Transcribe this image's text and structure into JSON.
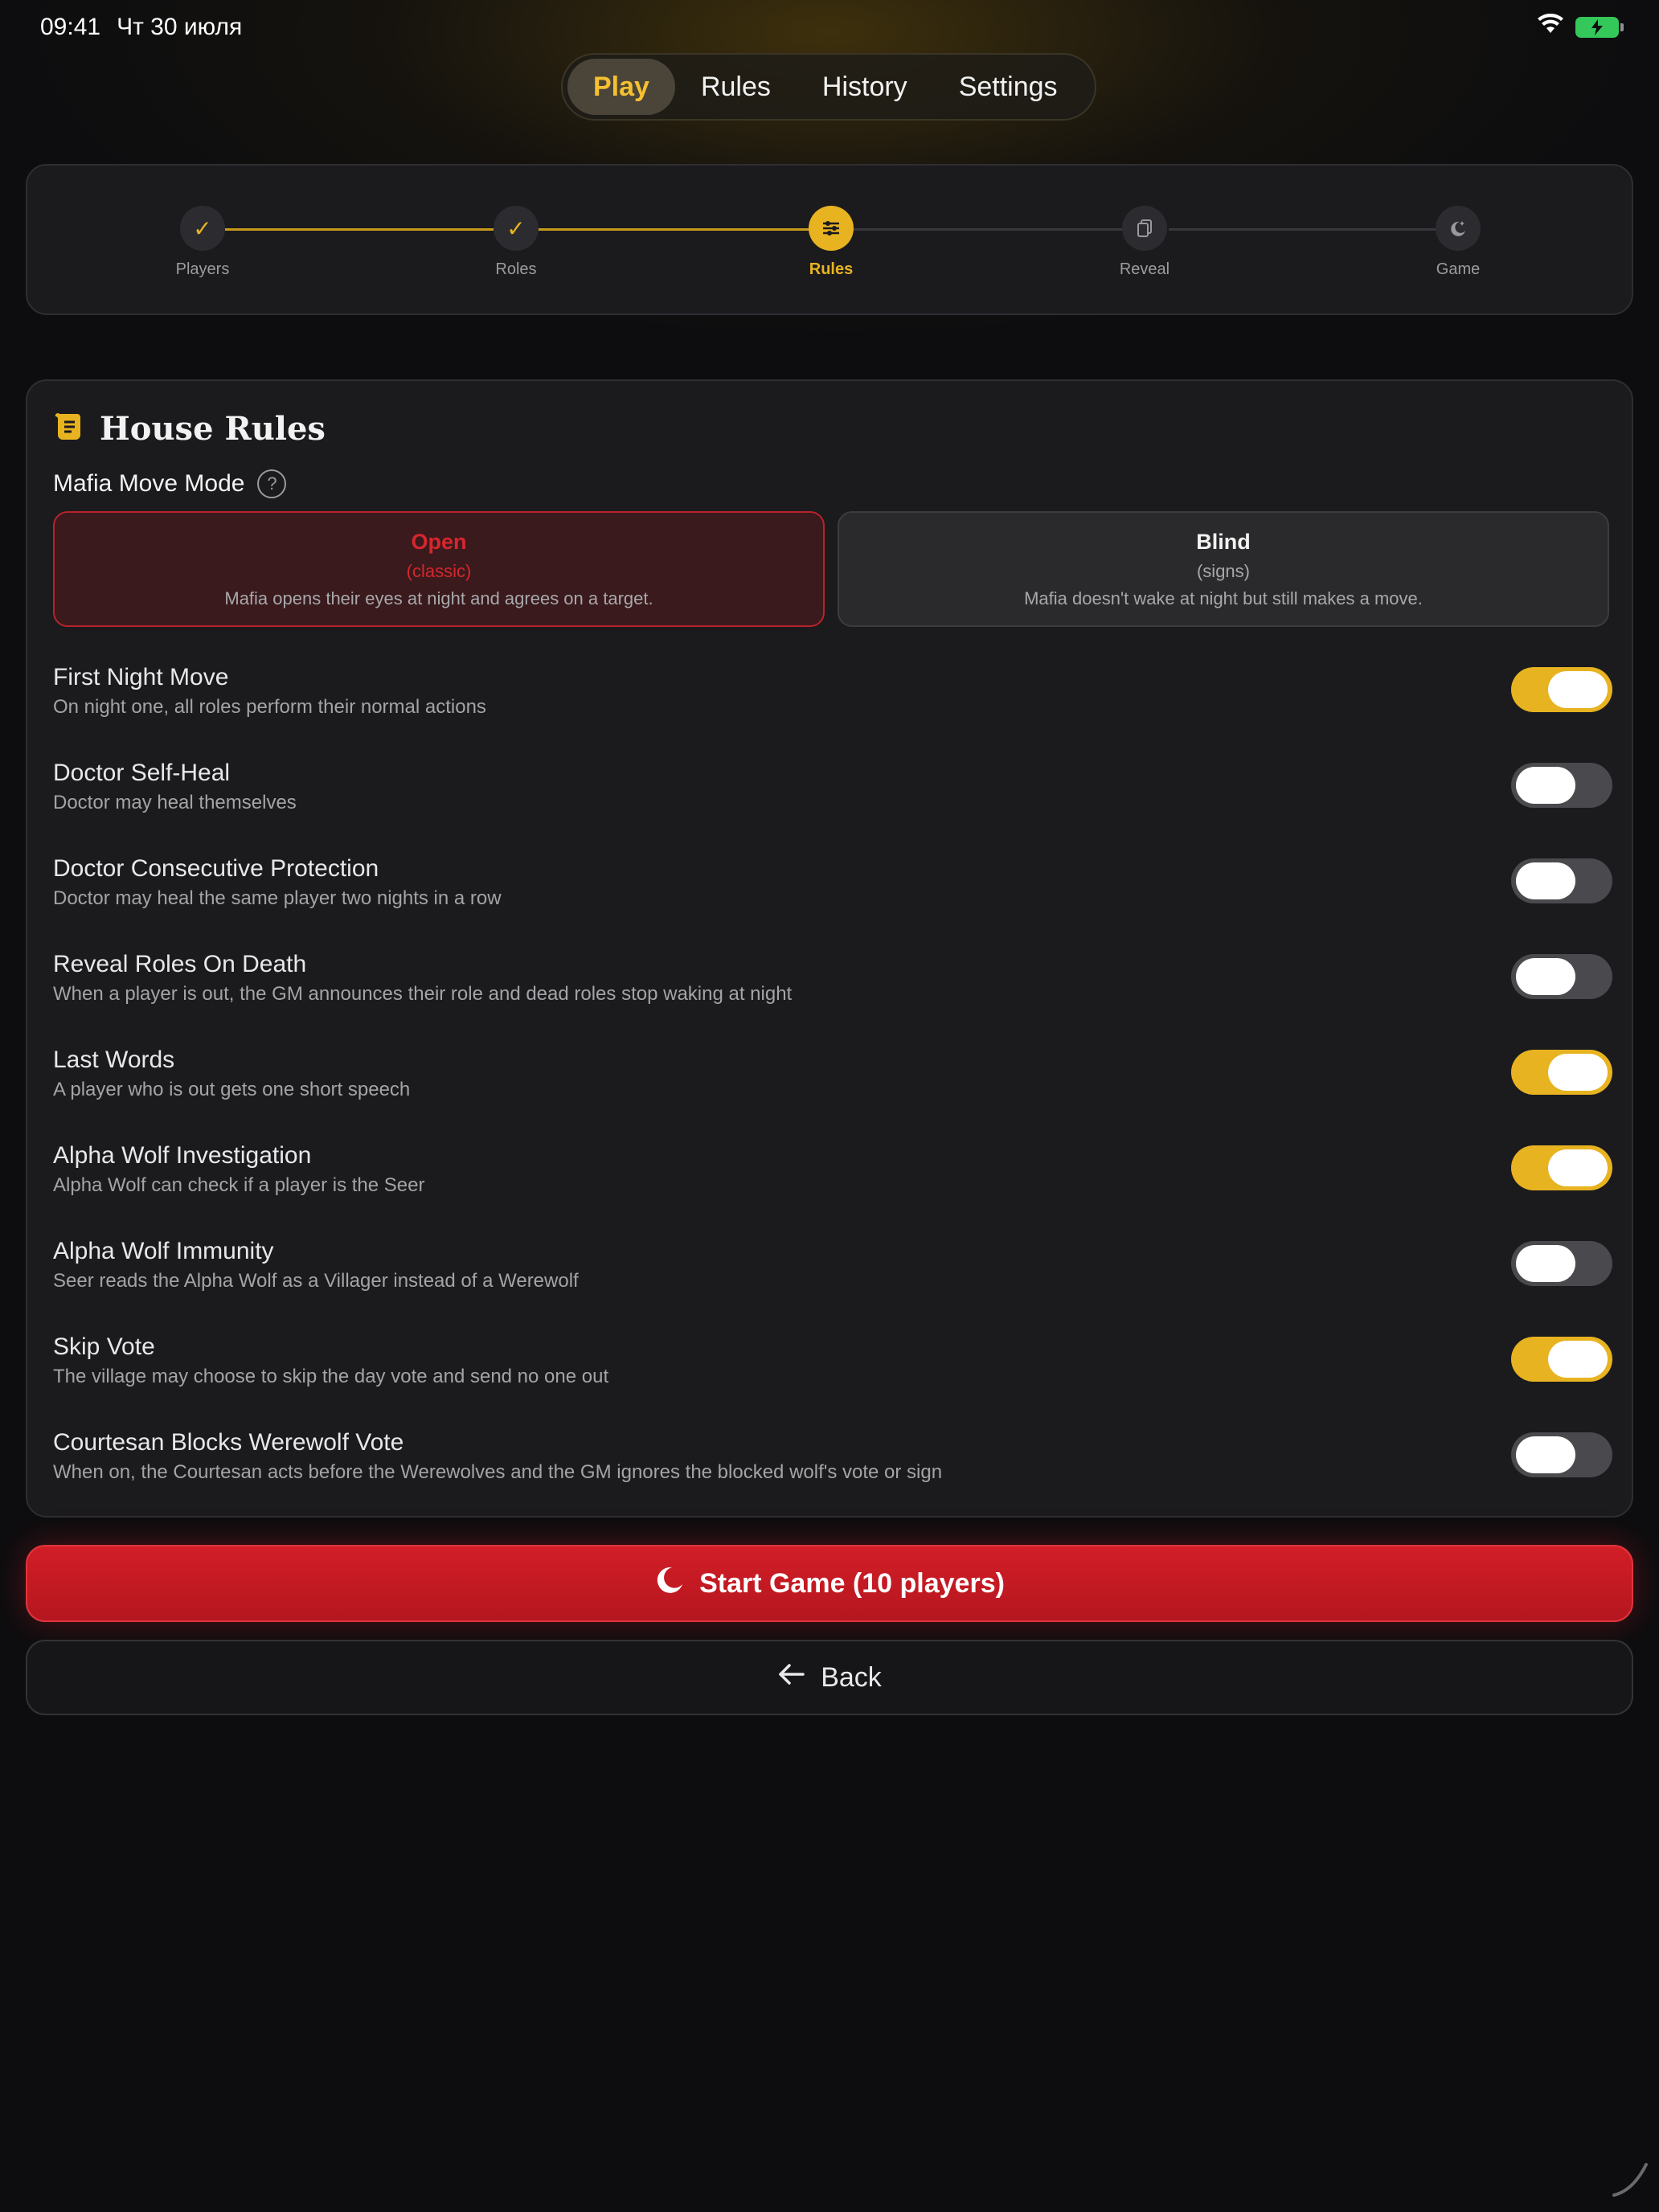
{
  "status_bar": {
    "time": "09:41",
    "date": "Чт 30 июля",
    "wifi_icon": "wifi-icon",
    "battery_icon": "battery-charging-icon"
  },
  "tabs": [
    {
      "label": "Play",
      "active": true
    },
    {
      "label": "Rules",
      "active": false
    },
    {
      "label": "History",
      "active": false
    },
    {
      "label": "Settings",
      "active": false
    }
  ],
  "stepper": {
    "steps": [
      {
        "label": "Players",
        "state": "done",
        "icon": "check-icon"
      },
      {
        "label": "Roles",
        "state": "done",
        "icon": "check-icon"
      },
      {
        "label": "Rules",
        "state": "current",
        "icon": "sliders-icon"
      },
      {
        "label": "Reveal",
        "state": "pending",
        "icon": "cards-icon"
      },
      {
        "label": "Game",
        "state": "pending",
        "icon": "moon-star-icon"
      }
    ]
  },
  "house_rules": {
    "title": "House Rules",
    "title_icon": "scroll-icon",
    "mafia_move_mode": {
      "label": "Mafia Move Mode",
      "help_icon": "question-circle-icon",
      "help_glyph": "?",
      "options": [
        {
          "name": "Open",
          "sub": "(classic)",
          "description": "Mafia opens their eyes at night and agrees on a target.",
          "selected": true
        },
        {
          "name": "Blind",
          "sub": "(signs)",
          "description": "Mafia doesn't wake at night but still makes a move.",
          "selected": false
        }
      ]
    },
    "rules": [
      {
        "title": "First Night Move",
        "description": "On night one, all roles perform their normal actions",
        "enabled": true
      },
      {
        "title": "Doctor Self-Heal",
        "description": "Doctor may heal themselves",
        "enabled": false
      },
      {
        "title": "Doctor Consecutive Protection",
        "description": "Doctor may heal the same player two nights in a row",
        "enabled": false
      },
      {
        "title": "Reveal Roles On Death",
        "description": "When a player is out, the GM announces their role and dead roles stop waking at night",
        "enabled": false
      },
      {
        "title": "Last Words",
        "description": "A player who is out gets one short speech",
        "enabled": true
      },
      {
        "title": "Alpha Wolf Investigation",
        "description": "Alpha Wolf can check if a player is the Seer",
        "enabled": true
      },
      {
        "title": "Alpha Wolf Immunity",
        "description": "Seer reads the Alpha Wolf as a Villager instead of a Werewolf",
        "enabled": false
      },
      {
        "title": "Skip Vote",
        "description": "The village may choose to skip the day vote and send no one out",
        "enabled": true
      },
      {
        "title": "Courtesan Blocks Werewolf Vote",
        "description": "When on, the Courtesan acts before the Werewolves and the GM ignores the blocked wolf's vote or sign",
        "enabled": false
      }
    ]
  },
  "actions": {
    "start_label": "Start Game (10 players)",
    "start_icon": "moon-icon",
    "back_label": "Back",
    "back_icon": "arrow-left-icon"
  },
  "colors": {
    "accent": "#e8b320",
    "danger": "#d21e27",
    "background": "#0d0d0f",
    "card": "#1b1b1e",
    "toggle_off": "#4a4a4e"
  }
}
